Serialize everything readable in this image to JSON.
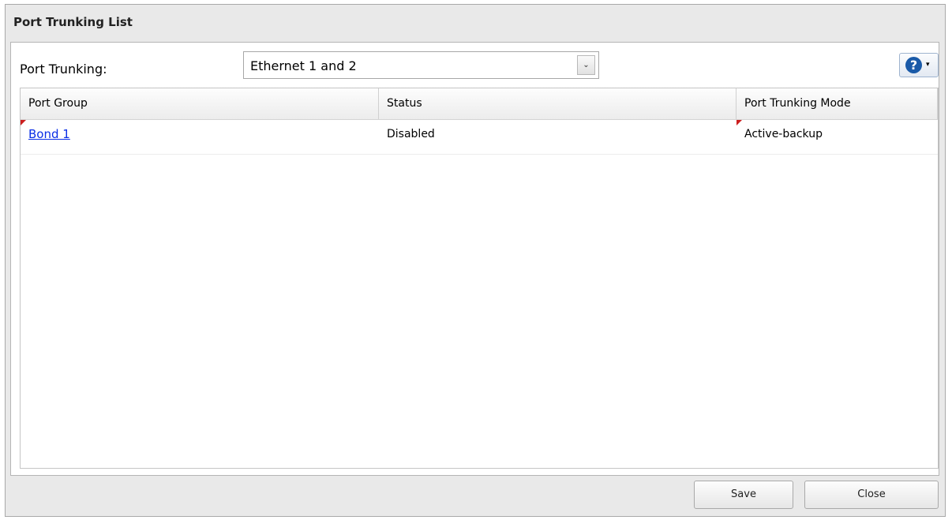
{
  "dialog": {
    "title": "Port Trunking List"
  },
  "help": {
    "icon": "question-icon",
    "glyph": "?",
    "arrow": "▾"
  },
  "form": {
    "label": "Port Trunking:",
    "select_value": "Ethernet 1 and 2",
    "select_arrow": "⌄"
  },
  "table": {
    "columns": [
      "Port Group",
      "Status",
      "Port Trunking Mode"
    ],
    "rows": [
      {
        "port_group": "Bond 1",
        "status": "Disabled",
        "mode": "Active-backup"
      }
    ]
  },
  "buttons": {
    "save": "Save",
    "close": "Close"
  },
  "colors": {
    "accent": "#1a5aa8",
    "link": "#0a2ee6",
    "dirty_marker": "#cc1f1f"
  }
}
